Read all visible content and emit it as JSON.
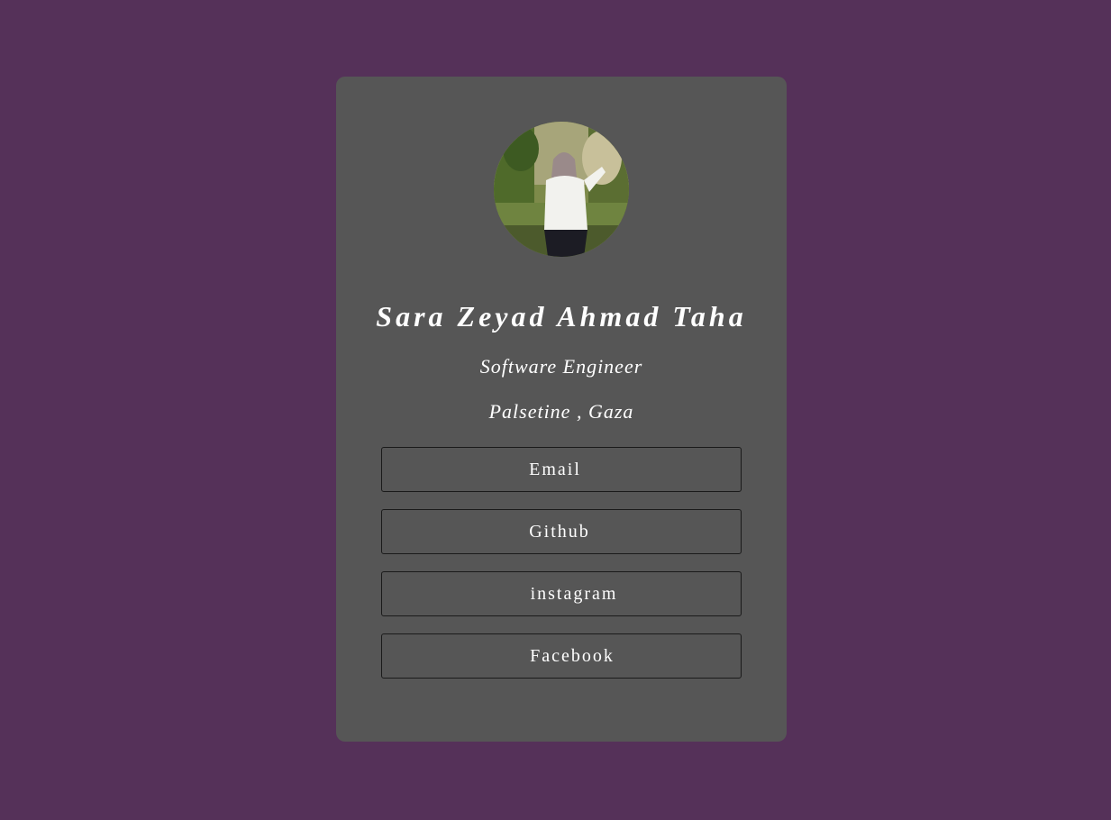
{
  "profile": {
    "name": "Sara Zeyad Ahmad Taha",
    "role": "Software Engineer",
    "location": "Palsetine , Gaza",
    "avatar_icon": "profile-photo"
  },
  "links": [
    {
      "label": "Email"
    },
    {
      "label": "Github"
    },
    {
      "label": "instagram"
    },
    {
      "label": "Facebook"
    }
  ],
  "colors": {
    "background": "#553159",
    "card": "#565656",
    "text": "#ffffff",
    "button_border": "#1a1a1a"
  }
}
